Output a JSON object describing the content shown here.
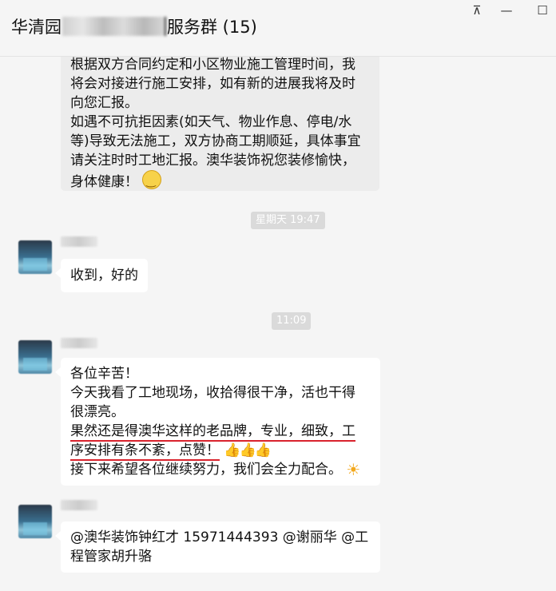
{
  "window": {
    "title_prefix": "华清园",
    "title_suffix": "服务群 (15)",
    "pin_icon": "⊼",
    "minimize_icon": "—",
    "maximize_icon": "☐"
  },
  "messages": {
    "first": {
      "lines": [
        "根据双方合同约定和小区物业施工管理时间，我",
        "将会对接进行施工安排，如有新的进展我将及时",
        "向您汇报。",
        "如遇不可抗拒因素(如天气、物业作息、停电/水",
        "等)导致无法施工，双方协商工期顺延，具体事宜",
        "请关注时时工地汇报。澳华装饰祝您装修愉快，",
        "身体健康！"
      ]
    },
    "time1": "星期天 19:47",
    "reply1": "收到，好的",
    "time2": "11:09",
    "reply2": {
      "line1": "各位辛苦！",
      "line2": "今天我看了工地现场，收拾得很干净，活也干得",
      "line3": "很漂亮。",
      "line4": "果然还是得澳华这样的老品牌，专业，细致，工",
      "line5": "序安排有条不紊，点赞！",
      "line6": "接下来希望各位继续努力，我们会全力配合。"
    },
    "reply3": {
      "line1": "@澳华装饰钟红才 15971444393 @谢丽华 @工",
      "line2": "程管家胡升骆"
    }
  },
  "icons": {
    "smile": "smile-emoji-icon",
    "thumbs": "👍👍👍",
    "sun": "☀"
  }
}
